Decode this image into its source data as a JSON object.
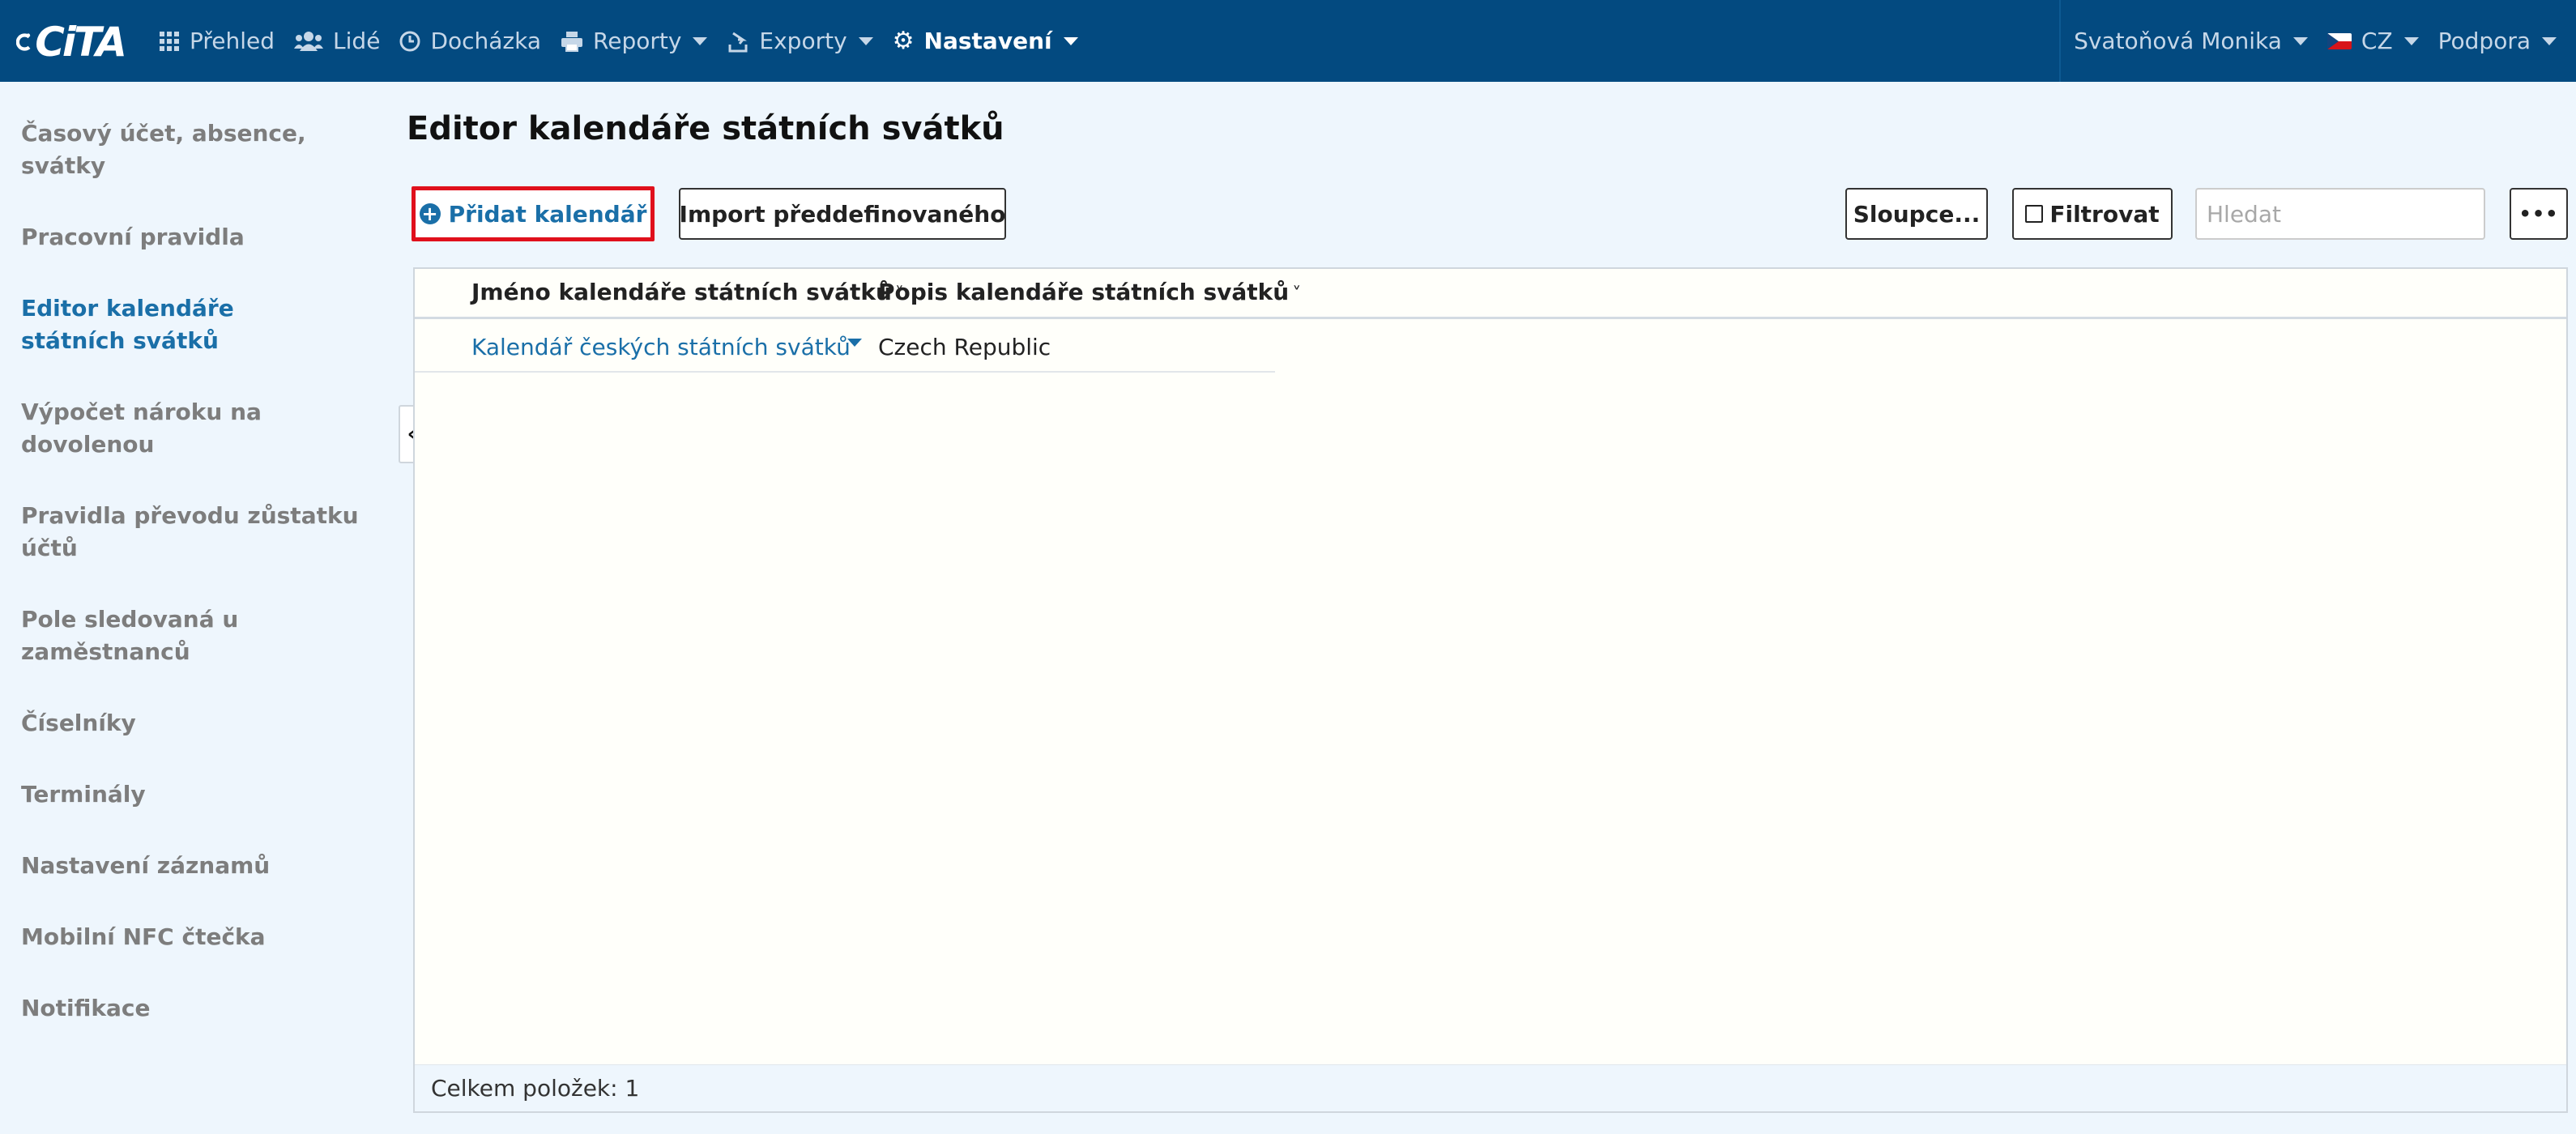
{
  "app": {
    "logo_text": "CiTA",
    "brand_color": "#034a80",
    "accent_color": "#1a6fa8"
  },
  "nav": {
    "items": [
      {
        "label": "Přehled",
        "icon": "grid-icon"
      },
      {
        "label": "Lidé",
        "icon": "users-icon"
      },
      {
        "label": "Docházka",
        "icon": "clock-icon"
      },
      {
        "label": "Reporty",
        "icon": "printer-icon"
      },
      {
        "label": "Exporty",
        "icon": "export-icon"
      },
      {
        "label": "Nastavení",
        "icon": "gear-icon",
        "active": true
      }
    ],
    "user": "Svatoňová Monika",
    "language": "CZ",
    "support": "Podpora"
  },
  "sidebar": {
    "items": [
      {
        "label": "Časový účet, absence, svátky"
      },
      {
        "label": "Pracovní pravidla"
      },
      {
        "label": "Editor kalendáře státních svátků",
        "active": true
      },
      {
        "label": "Výpočet nároku na dovolenou"
      },
      {
        "label": "Pravidla převodu zůstatku účtů"
      },
      {
        "label": "Pole sledovaná u zaměstnanců"
      },
      {
        "label": "Číselníky"
      },
      {
        "label": "Terminály"
      },
      {
        "label": "Nastavení záznamů"
      },
      {
        "label": "Mobilní NFC čtečka"
      },
      {
        "label": "Notifikace"
      }
    ]
  },
  "main": {
    "title": "Editor kalendáře státních svátků",
    "toolbar": {
      "add_label": "Přidat kalendář",
      "import_label": "Import předdefinovaného",
      "columns_label": "Sloupce...",
      "filter_label": "Filtrovat",
      "search_placeholder": "Hledat",
      "more_label": "•••"
    },
    "table": {
      "columns": [
        "Jméno kalendáře státních svátků",
        "Popis kalendáře státních svátků"
      ],
      "rows": [
        {
          "name": "Kalendář českých státních svátků",
          "description": "Czech Republic"
        }
      ],
      "footer": "Celkem položek: 1"
    }
  }
}
